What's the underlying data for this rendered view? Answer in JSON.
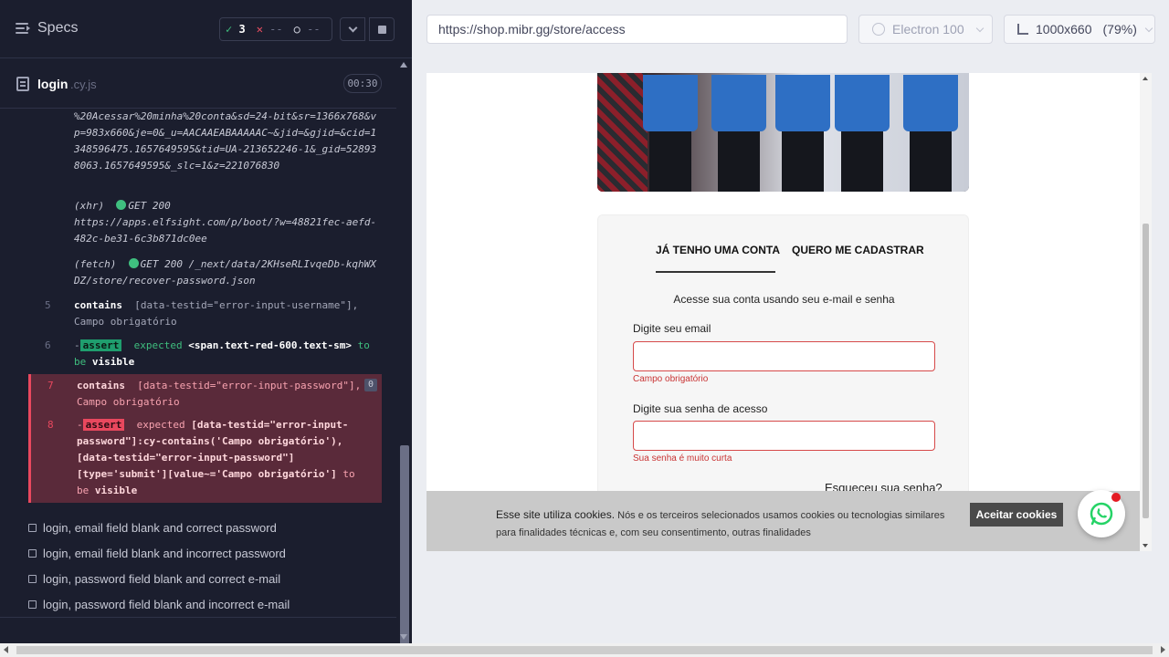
{
  "specs": {
    "title": "Specs",
    "passed": "3",
    "failed": "--",
    "pending": "--"
  },
  "file": {
    "name": "login",
    "ext": ".cy.js",
    "time": "00:30"
  },
  "log": {
    "url_frag": "%20Acessar%20minha%20conta&sd=24-bit&sr=1366x768&vp=983x660&je=0&_u=AACAAEABAAAAAC~&jid=&gjid=&cid=1348596475.1657649595&tid=UA-213652246-1&_gid=528938063.1657649595&_slc=1&z=221076830",
    "xhr_label": "(xhr)",
    "xhr_status": "GET 200",
    "xhr_url": "https://apps.elfsight.com/p/boot/?w=48821fec-aefd-482c-be31-6c3b871dc0ee",
    "fetch_label": "(fetch)",
    "fetch_status": "GET 200 /_next/data/2KHseRLIvqeDb-kqhWXDZ/store/recover-password.json",
    "cmd5_num": "5",
    "cmd5_kw": "contains",
    "cmd5_args": "[data-testid=\"error-input-username\"], Campo obrigatório",
    "cmd6_num": "6",
    "cmd6_dash": "-",
    "cmd6_badge": "assert",
    "cmd6_a": "expected",
    "cmd6_b": "<span.text-red-600.text-sm>",
    "cmd6_c": "to be",
    "cmd6_d": "visible",
    "cmd7_num": "7",
    "cmd7_kw": "contains",
    "cmd7_args": "[data-testid=\"error-input-password\"], Campo obrigatório",
    "cmd7_badge": "0",
    "cmd8_num": "8",
    "cmd8_dash": "-",
    "cmd8_badge": "assert",
    "cmd8_a": "expected",
    "cmd8_b": "[data-testid=\"error-input-password\"]:cy-contains('Campo obrigatório'), [data-testid=\"error-input-password\"] [type='submit'][value~='Campo obrigatório']",
    "cmd8_c": "to be",
    "cmd8_d": "visible"
  },
  "tests": [
    "login, email field blank and correct password",
    "login, email field blank and incorrect password",
    "login, password field blank and correct e-mail",
    "login, password field blank and incorrect e-mail"
  ],
  "preview": {
    "url": "https://shop.mibr.gg/store/access",
    "browser": "Electron 100",
    "viewport": "1000x660",
    "zoom": "(79%)"
  },
  "site": {
    "tab_login": "JÁ TENHO UMA CONTA",
    "tab_register": "QUERO ME CADASTRAR",
    "subtitle": "Acesse sua conta usando seu e-mail e senha",
    "email_label": "Digite seu email",
    "email_error": "Campo obrigatório",
    "password_label": "Digite sua senha de acesso",
    "password_error": "Sua senha é muito curta",
    "forgot": "Esqueceu sua senha?",
    "cookie_strong": "Esse site utiliza cookies.",
    "cookie_text": "Nós e os terceiros selecionados usamos cookies ou tecnologias similares para finalidades técnicas e, com seu consentimento, outras finalidades",
    "cookie_button": "Aceitar cookies"
  },
  "colors": {
    "pass": "#3fbf7f",
    "fail": "#e9485e",
    "error": "#c93434",
    "whatsapp": "#25d366"
  }
}
